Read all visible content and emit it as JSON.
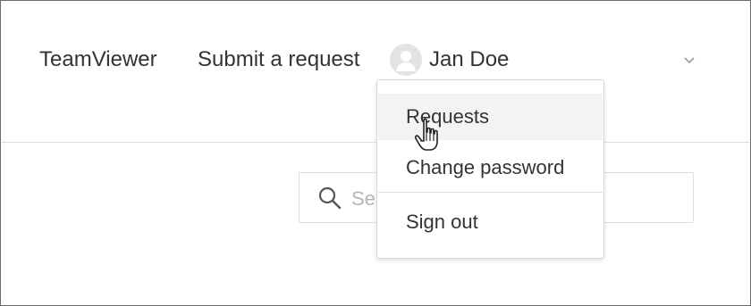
{
  "header": {
    "brand": "TeamViewer",
    "submit_request": "Submit a request",
    "user_name": "Jan Doe"
  },
  "user_menu": {
    "items": [
      {
        "label": "Requests"
      },
      {
        "label": "Change password"
      },
      {
        "label": "Sign out"
      }
    ]
  },
  "search": {
    "placeholder": "Search"
  },
  "icons": {
    "avatar": "user-avatar-icon",
    "chevron": "chevron-down-icon",
    "search": "search-icon",
    "cursor": "hand-pointer-cursor"
  },
  "colors": {
    "text": "#333333",
    "menu_hover": "#f3f3f3",
    "border": "#dddddd"
  }
}
